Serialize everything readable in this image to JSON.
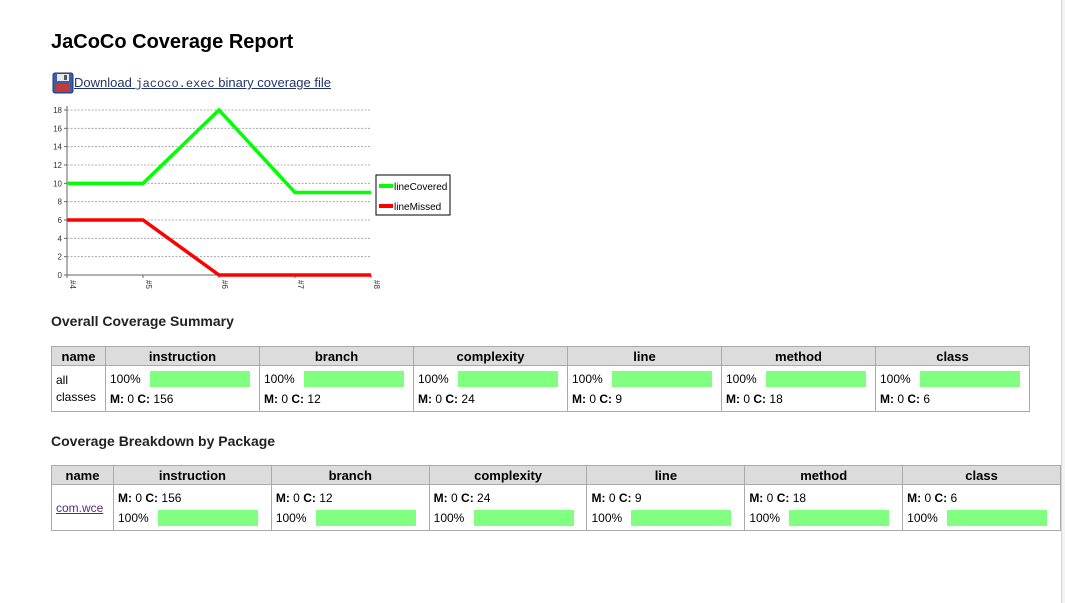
{
  "title": "JaCoCo Coverage Report",
  "download": {
    "prefix": "Download ",
    "code": "jacoco.exec",
    "suffix": " binary coverage file",
    "icon": "floppy-disk-icon"
  },
  "chart_data": {
    "type": "line",
    "x": [
      "#4",
      "#5",
      "#6",
      "#7",
      "#8"
    ],
    "ylim": [
      0,
      18
    ],
    "yticks": [
      0,
      2,
      4,
      6,
      8,
      10,
      12,
      14,
      16,
      18
    ],
    "grid": true,
    "legend_position": "right",
    "series": [
      {
        "name": "lineCovered",
        "color": "#00ff00",
        "values": [
          10,
          10,
          18,
          9,
          9
        ]
      },
      {
        "name": "lineMissed",
        "color": "#ff0000",
        "values": [
          6,
          6,
          0,
          0,
          0
        ]
      }
    ]
  },
  "overall": {
    "heading": "Overall Coverage Summary",
    "headers": [
      "name",
      "instruction",
      "branch",
      "complexity",
      "line",
      "method",
      "class"
    ],
    "row": {
      "name_line1": "all",
      "name_line2": "classes",
      "cells": [
        {
          "pct": "100%",
          "m": "0",
          "c": "156"
        },
        {
          "pct": "100%",
          "m": "0",
          "c": "12"
        },
        {
          "pct": "100%",
          "m": "0",
          "c": "24"
        },
        {
          "pct": "100%",
          "m": "0",
          "c": "9"
        },
        {
          "pct": "100%",
          "m": "0",
          "c": "18"
        },
        {
          "pct": "100%",
          "m": "0",
          "c": "6"
        }
      ]
    }
  },
  "breakdown": {
    "heading": "Coverage Breakdown by Package",
    "headers": [
      "name",
      "instruction",
      "branch",
      "complexity",
      "line",
      "method",
      "class"
    ],
    "row": {
      "name": "com.wce",
      "cells": [
        {
          "pct": "100%",
          "m": "0",
          "c": "156"
        },
        {
          "pct": "100%",
          "m": "0",
          "c": "12"
        },
        {
          "pct": "100%",
          "m": "0",
          "c": "24"
        },
        {
          "pct": "100%",
          "m": "0",
          "c": "9"
        },
        {
          "pct": "100%",
          "m": "0",
          "c": "18"
        },
        {
          "pct": "100%",
          "m": "0",
          "c": "6"
        }
      ]
    }
  },
  "labels": {
    "m": "M:",
    "c": "C:"
  },
  "colors": {
    "bar": "#80ff80",
    "header_bg": "#dcdcdc",
    "link": "#22346b"
  }
}
